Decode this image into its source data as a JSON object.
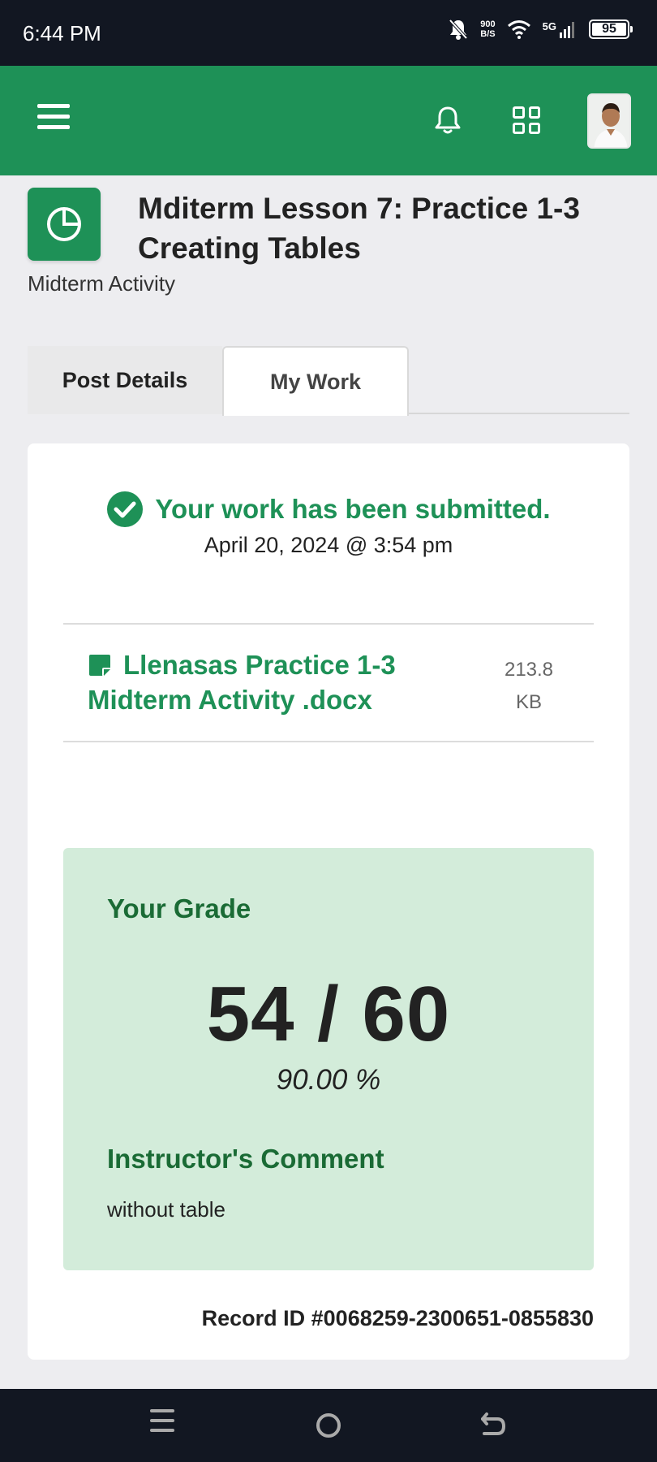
{
  "status_bar": {
    "time": "6:44 PM",
    "net_speed_value": "900",
    "net_speed_unit": "B/S",
    "network": "5G",
    "battery": "95"
  },
  "app_bar": {
    "icons": [
      "menu-icon",
      "bell-icon",
      "apps-grid-icon",
      "avatar"
    ],
    "color": "#1e9157"
  },
  "post": {
    "title": "Mditerm Lesson 7: Practice 1-3 Creating Tables",
    "subtitle": "Midterm Activity"
  },
  "tabs": [
    {
      "label": "Post Details",
      "active": false
    },
    {
      "label": "My Work",
      "active": true
    }
  ],
  "submission": {
    "status": "Your work has been submitted.",
    "date": "April 20, 2024 @ 3:54 pm",
    "file": {
      "name": "Llenasas Practice 1-3 Midterm Activity .docx",
      "size_value": "213.8",
      "size_unit": "KB"
    }
  },
  "grade": {
    "label": "Your Grade",
    "score": "54 / 60",
    "percent": "90.00 %",
    "comment_label": "Instructor's Comment",
    "comment": "without table"
  },
  "record_id": "Record ID #0068259-2300651-0855830",
  "colors": {
    "primary": "#1e9157",
    "grade_bg": "#d3ecda",
    "grade_heading": "#1a6b35"
  }
}
